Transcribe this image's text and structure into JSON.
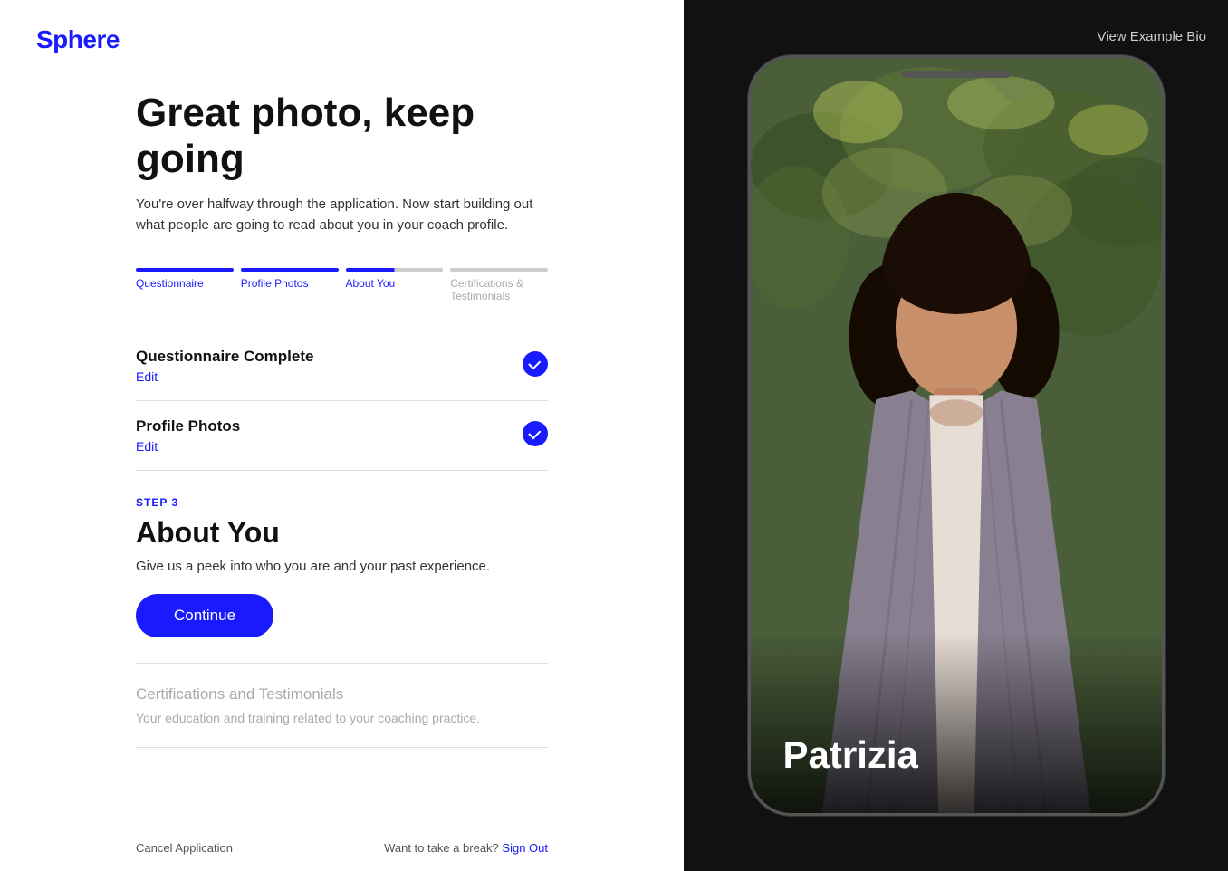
{
  "logo": {
    "text": "Sphere"
  },
  "header": {
    "title": "Great photo, keep going",
    "subtitle": "You're over halfway through the application. Now start building out what people are going to read about you in your coach profile."
  },
  "progress": {
    "segments": [
      {
        "status": "complete",
        "label": "Questionnaire"
      },
      {
        "status": "complete",
        "label": "Profile Photos"
      },
      {
        "status": "partial",
        "label": "About You"
      },
      {
        "status": "inactive",
        "label": "Certifications & Testimonials"
      }
    ]
  },
  "completed_sections": [
    {
      "title": "Questionnaire Complete",
      "edit_label": "Edit"
    },
    {
      "title": "Profile Photos",
      "edit_label": "Edit"
    }
  ],
  "current_step": {
    "step_label": "STEP 3",
    "title": "About You",
    "description": "Give us a peek into who you are and your past experience.",
    "button_label": "Continue"
  },
  "upcoming_section": {
    "title": "Certifications and Testimonials",
    "description": "Your education and training related to your coaching practice."
  },
  "footer": {
    "cancel_label": "Cancel Application",
    "break_text": "Want to take a break?",
    "signout_label": "Sign Out"
  },
  "right_panel": {
    "view_example_bio_label": "View Example Bio",
    "profile_name": "Patrizia"
  }
}
